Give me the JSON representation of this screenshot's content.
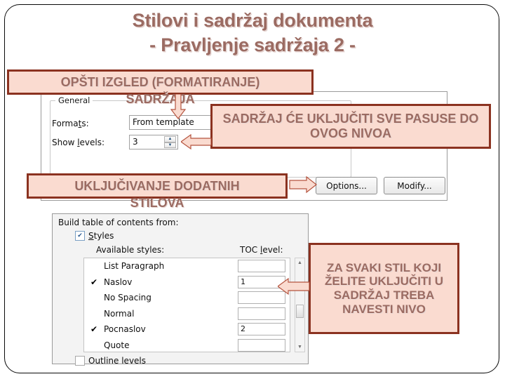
{
  "slide": {
    "title_line1": "Stilovi i sadržaj dokumenta",
    "title_line2": "- Pravljenje sadržaja 2 -",
    "title_color": "#9b6b62",
    "callout_fill": "#fadbd0",
    "callout_border": "#8b3220"
  },
  "callouts": {
    "formatting": {
      "line1": "OPŠTI IZGLED (FORMATIRANJE)",
      "line2": "SADRŽAJA"
    },
    "levels": {
      "text": "SADRŽAJ ĆE UKLJUČITI SVE PASUSE DO OVOG NIVOA"
    },
    "extra_styles": {
      "line1": "UKLJUČIVANJE DODATNIH",
      "line2": "STILOVA"
    },
    "toc_level": {
      "text": "ZA SVAKI STIL KOJI ŽELITE UKLJUČITI U SADRŽAJ TREBA NAVESTI NIVO"
    }
  },
  "dialog_top": {
    "group_label": "General",
    "formats_label": "Formats:",
    "formats_value": "From template",
    "show_levels_label": "Show levels:",
    "show_levels_value": "3",
    "spinner_up": "▲",
    "spinner_down": "▼",
    "buttons": [
      {
        "label": "Options...",
        "name": "options-button"
      },
      {
        "label": "Modify...",
        "name": "modify-button"
      }
    ]
  },
  "dialog_bottom": {
    "build_from_label": "Build table of contents from:",
    "styles_checkbox_label": "Styles",
    "styles_checked": "✔",
    "available_styles_label": "Available styles:",
    "toc_level_label": "TOC level:",
    "outline_levels_label": "Outline levels",
    "rows": [
      {
        "check": "",
        "name": "List Paragraph",
        "level": ""
      },
      {
        "check": "✔",
        "name": "Naslov",
        "level": "1"
      },
      {
        "check": "",
        "name": "No Spacing",
        "level": ""
      },
      {
        "check": "",
        "name": "Normal",
        "level": ""
      },
      {
        "check": "✔",
        "name": "Pocnaslov",
        "level": "2"
      },
      {
        "check": "",
        "name": "Quote",
        "level": ""
      }
    ],
    "scrollbar": {
      "up": "▲",
      "down": "▼"
    }
  }
}
